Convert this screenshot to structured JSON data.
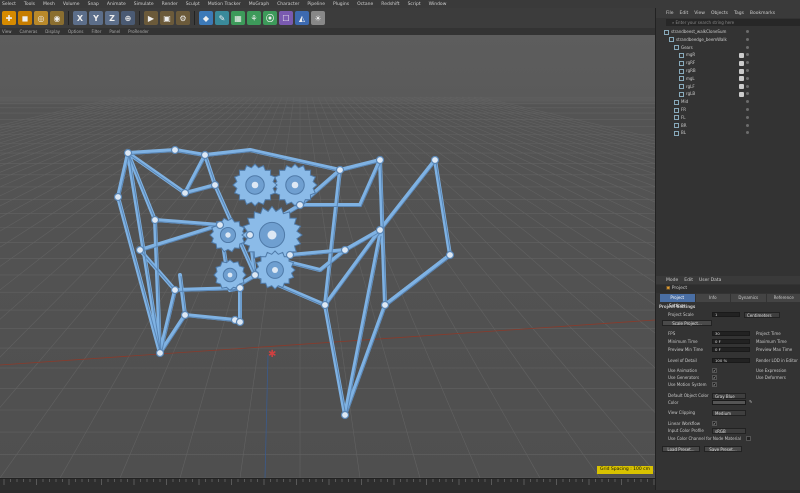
{
  "menu": [
    "Select",
    "Tools",
    "Mesh",
    "Volume",
    "Snap",
    "Animate",
    "Simulate",
    "Render",
    "Sculpt",
    "Motion Tracker",
    "MoGraph",
    "Character",
    "Pipeline",
    "Plugins",
    "Octane",
    "Redshift",
    "Script",
    "Window",
    "File",
    "Edit",
    "View",
    "Objects",
    "Tags",
    "Bookmarks"
  ],
  "toolbar": {
    "x": "X",
    "y": "Y",
    "z": "Z"
  },
  "viewport_menu": [
    "View",
    "Cameras",
    "Display",
    "Options",
    "Filter",
    "Panel",
    "ProRender"
  ],
  "grid_spacing": "Grid Spacing : 100 cm",
  "object_manager": {
    "menu": [
      "File",
      "Edit",
      "View",
      "Objects",
      "Tags",
      "Bookmarks"
    ],
    "search_placeholder": "Enter your search string here",
    "objects": [
      {
        "name": "strandbeest_walkCloneSum",
        "indent": 0
      },
      {
        "name": "strandbeedge_beemWalk",
        "indent": 1
      },
      {
        "name": "Gears",
        "indent": 2
      },
      {
        "name": "mgR",
        "indent": 3
      },
      {
        "name": "rgRF",
        "indent": 3
      },
      {
        "name": "rgRB",
        "indent": 3
      },
      {
        "name": "mgL",
        "indent": 3
      },
      {
        "name": "rgLF",
        "indent": 3
      },
      {
        "name": "rgLB",
        "indent": 3
      },
      {
        "name": "Mid",
        "indent": 2
      },
      {
        "name": "FR",
        "indent": 2
      },
      {
        "name": "FL",
        "indent": 2
      },
      {
        "name": "BR",
        "indent": 2
      },
      {
        "name": "BL",
        "indent": 2
      }
    ]
  },
  "attributes": {
    "menu": [
      "Mode",
      "Edit",
      "User Data"
    ],
    "object": "Project",
    "tabs": [
      "Project Settings",
      "Info",
      "Dynamics",
      "Reference"
    ],
    "section": "Project Settings",
    "project_scale_label": "Project Scale",
    "project_scale_value": "1",
    "project_scale_unit": "Centimeters",
    "scale_button": "Scale Project...",
    "fps_label": "FPS",
    "fps_value": "30",
    "project_time_label": "Project Time",
    "min_time_label": "Minimum Time",
    "min_time_value": "0 F",
    "max_time_label": "Maximum Time",
    "preview_min_label": "Preview Min Time",
    "preview_min_value": "0 F",
    "preview_max_label": "Preview Max Time",
    "lod_label": "Level of Detail",
    "lod_value": "100 %",
    "render_lod_label": "Render LOD in Editor",
    "use_animation": "Use Animation",
    "use_expression": "Use Expression",
    "use_generators": "Use Generators",
    "use_deformers": "Use Deformers",
    "use_motion_system": "Use Motion System",
    "default_object_color_label": "Default Object Color",
    "default_object_color_value": "Gray Blue",
    "color_label": "Color",
    "view_clipping_label": "View Clipping",
    "view_clipping_value": "Medium",
    "linear_workflow_label": "Linear Workflow",
    "input_color_profile_label": "Input Color Profile",
    "input_color_profile_value": "sRGB",
    "use_color_channel_label": "Use Color Channel for Node Material",
    "load_preset": "Load Preset...",
    "save_preset": "Save Preset..."
  },
  "colors": {
    "model": "#7fb2e3",
    "model_dark": "#5a86b5",
    "accent": "#4a6fa5",
    "grid_label": "#d8c200"
  }
}
